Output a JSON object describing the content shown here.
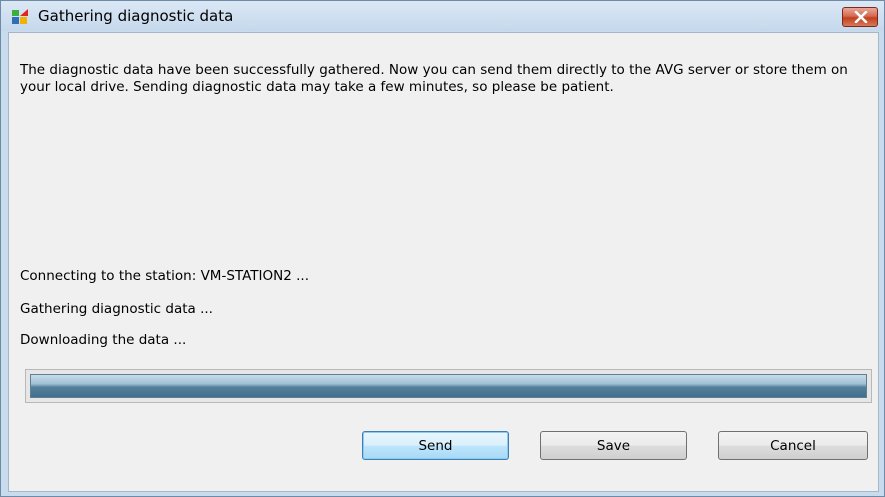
{
  "window": {
    "title": "Gathering diagnostic data",
    "close_icon": "close-icon"
  },
  "message": "The diagnostic data have been successfully gathered. Now you can send them directly to the AVG server or store them on your local drive. Sending diagnostic data may take a few minutes, so please be patient.",
  "status": {
    "lines": [
      "Connecting to the station: VM-STATION2 ...",
      "Gathering diagnostic data ...",
      "Downloading the data ..."
    ]
  },
  "progress": {
    "fraction": 1.0
  },
  "buttons": {
    "send": "Send",
    "save": "Save",
    "cancel": "Cancel"
  },
  "colors": {
    "accent": "#3c7fb1",
    "progress": "#3f6f8c",
    "close": "#c0401f"
  }
}
